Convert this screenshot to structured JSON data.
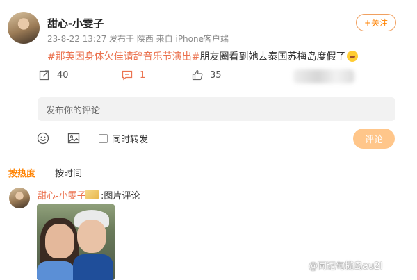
{
  "post": {
    "author": "甜心-小雯子",
    "meta": "23-8-22 13:27  发布于 陕西  来自 iPhone客户端",
    "follow_label": "+关注",
    "topic": "#那英因身体欠佳请辞音乐节演出#",
    "text": "朋友圈看到她去泰国苏梅岛度假了",
    "emoji_icon": "laughing-emoji-icon"
  },
  "actions": {
    "share_count": "40",
    "comment_count": "1",
    "like_count": "35"
  },
  "composer": {
    "placeholder": "发布你的评论",
    "repost_label": "同时转发",
    "submit_label": "评论"
  },
  "sort": {
    "hot_label": "按热度",
    "time_label": "按时间"
  },
  "comment": {
    "author": "甜心-小雯子",
    "text": ":图片评论"
  },
  "watermark": "@同记句揽岛au2l",
  "colors": {
    "accent": "#ff8200",
    "topic": "#eb7350",
    "input_bg": "#f2f2f2",
    "submit_disabled": "#ffc68a"
  }
}
